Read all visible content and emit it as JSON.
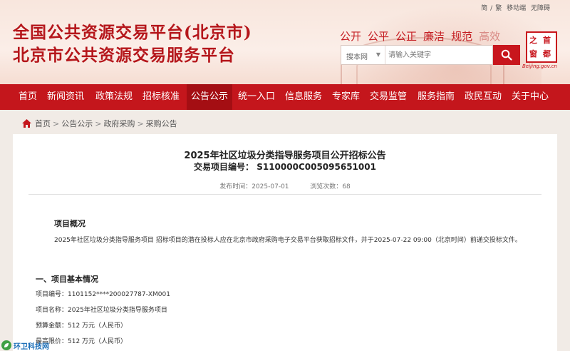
{
  "header": {
    "title_line1": "全国公共资源交易平台(北京市)",
    "title_line2": "北京市公共资源交易服务平台",
    "top_links": [
      "简",
      "/",
      "繁",
      "移动端",
      "无障碍"
    ],
    "slogans": [
      "公开",
      "公平",
      "公正",
      "廉洁",
      "规范",
      "高效"
    ],
    "search": {
      "scope": "搜本网",
      "placeholder": "请输入关键字"
    },
    "logo": {
      "chars": [
        "首",
        "都",
        "之",
        "窗"
      ],
      "en": "Beijing.gov.cn"
    }
  },
  "nav": {
    "items": [
      "首页",
      "新闻资讯",
      "政策法规",
      "招标核准",
      "公告公示",
      "统一入口",
      "信息服务",
      "专家库",
      "交易监管",
      "服务指南",
      "政民互动",
      "关于中心"
    ],
    "active_index": 4
  },
  "breadcrumb": [
    "首页",
    "公告公示",
    "政府采购",
    "采购公告"
  ],
  "document": {
    "title": "2025年社区垃圾分类指导服务项目公开招标公告",
    "code_line": "交易项目编号： S110000C005095651001",
    "published_label": "发布时间：",
    "published_value": "2025-07-01",
    "views_label": "浏览次数：",
    "views_value": "68",
    "overview_heading": "项目概况",
    "overview_text": "2025年社区垃圾分类指导服务项目 招标项目的潜在投标人应在北京市政府采购电子交易平台获取招标文件，并于2025-07-22 09:00（北京时间）前递交投标文件。",
    "section1_heading": "一、项目基本情况",
    "fields": [
      "项目编号：1101152****200027787-XM001",
      "项目名称：2025年社区垃圾分类指导服务项目",
      "预算金额：512 万元（人民币）",
      "最高限价：512 万元（人民币）"
    ]
  },
  "watermark": "环卫科技网",
  "colors": {
    "brand_red": "#c4161c",
    "nav_active": "#a40e13"
  }
}
